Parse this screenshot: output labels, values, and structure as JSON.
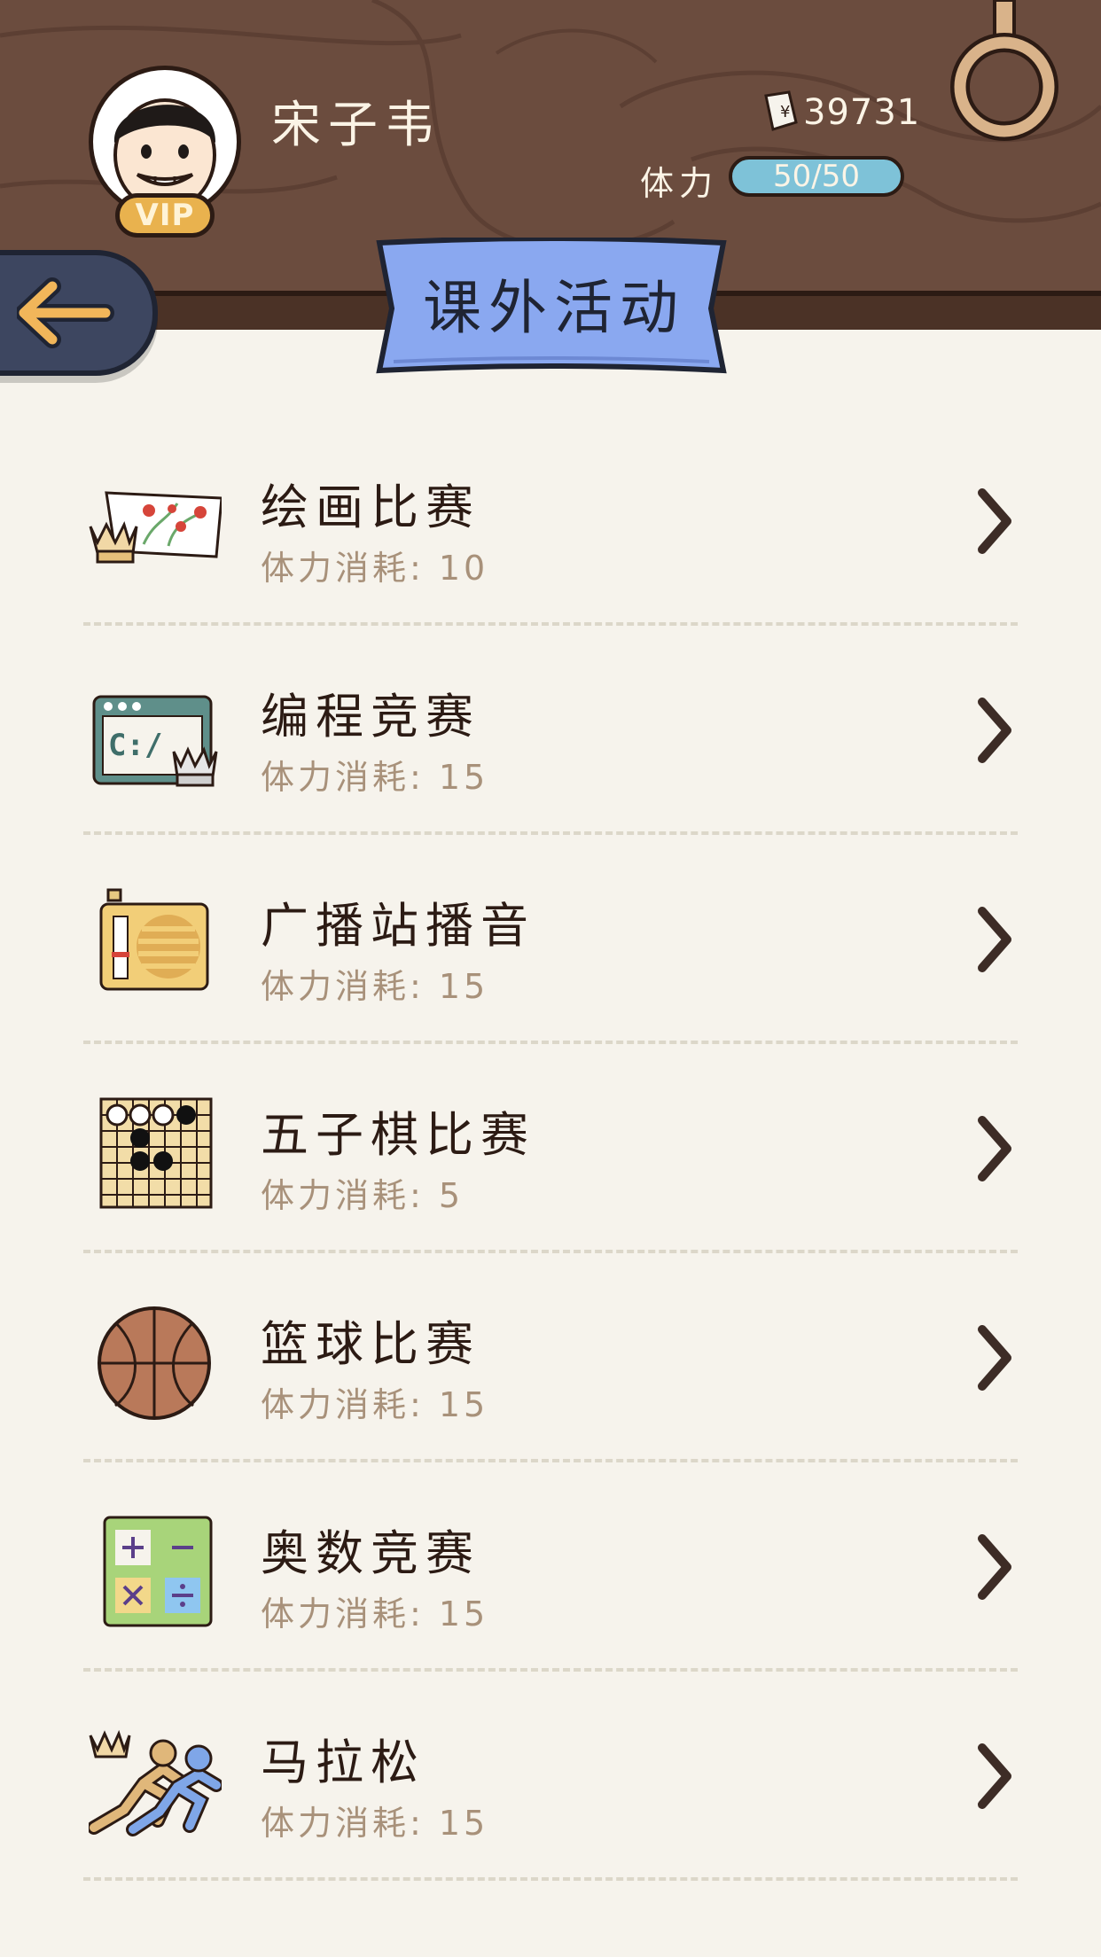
{
  "user": {
    "name": "宋子韦",
    "vip_label": "VIP",
    "money": "39731",
    "stamina_label": "体力",
    "stamina_value": "50/50"
  },
  "page": {
    "title": "课外活动"
  },
  "activities": [
    {
      "name": "绘画比赛",
      "cost": "体力消耗: 10",
      "icon": "painting-icon"
    },
    {
      "name": "编程竞赛",
      "cost": "体力消耗: 15",
      "icon": "programming-icon"
    },
    {
      "name": "广播站播音",
      "cost": "体力消耗: 15",
      "icon": "radio-icon"
    },
    {
      "name": "五子棋比赛",
      "cost": "体力消耗: 5",
      "icon": "gomoku-icon"
    },
    {
      "name": "篮球比赛",
      "cost": "体力消耗: 15",
      "icon": "basketball-icon"
    },
    {
      "name": "奥数竞赛",
      "cost": "体力消耗: 15",
      "icon": "math-icon"
    },
    {
      "name": "马拉松",
      "cost": "体力消耗: 15",
      "icon": "marathon-icon"
    }
  ],
  "colors": {
    "header_wood": "#6b4c3e",
    "background": "#f6f3ec",
    "banner": "#8aa8f0",
    "stamina_bar": "#7ec2d8",
    "text_dark": "#2c1b14",
    "text_muted": "#a8917a"
  }
}
